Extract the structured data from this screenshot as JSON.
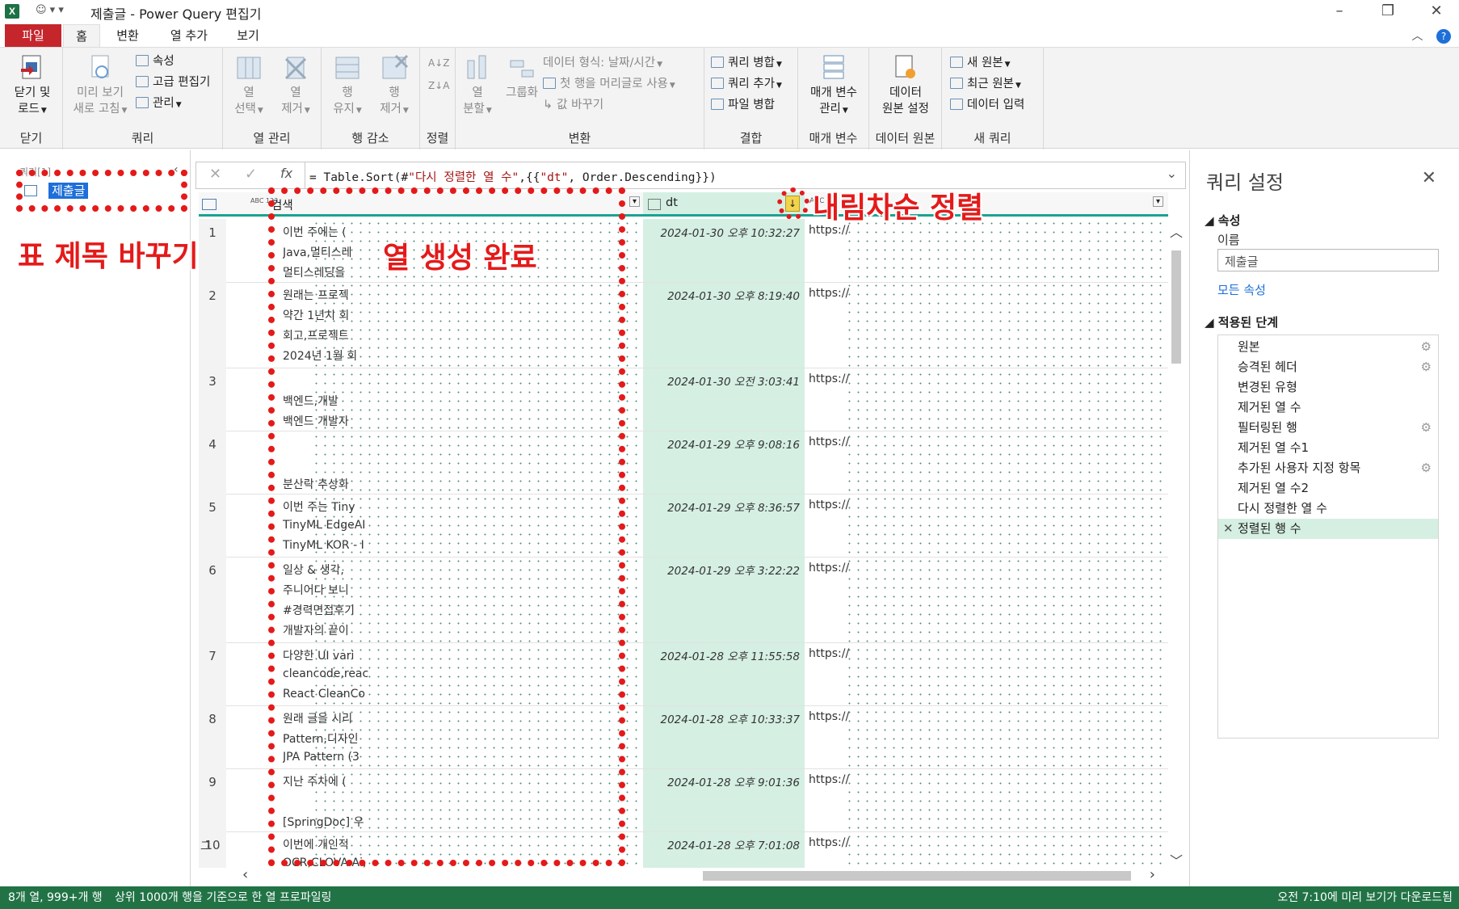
{
  "window": {
    "title": "제출글 - Power Query 편집기",
    "app_icon": "X"
  },
  "tabs": [
    "파일",
    "홈",
    "변환",
    "열 추가",
    "보기"
  ],
  "ribbon": {
    "close": {
      "label1": "닫기 및",
      "label2": "로드",
      "group": "닫기"
    },
    "query": {
      "group": "쿼리",
      "preview1": "미리 보기",
      "preview2": "새로 고침",
      "properties": "속성",
      "advanced": "고급 편집기",
      "manage": "관리"
    },
    "columns": {
      "group": "열 관리",
      "choose1": "열",
      "choose2": "선택",
      "remove1": "열",
      "remove2": "제거"
    },
    "rows": {
      "group": "행 감소",
      "keep1": "행",
      "keep2": "유지",
      "remove1": "행",
      "remove2": "제거"
    },
    "sort": {
      "group": "정렬"
    },
    "transform": {
      "group": "변환",
      "split1": "열",
      "split2": "분할",
      "groupby": "그룹화",
      "datatype": "데이터 형식: 날짜/시간",
      "firstrow": "첫 행을 머리글로 사용",
      "replace": "값 바꾸기"
    },
    "combine": {
      "group": "결합",
      "merge": "쿼리 병합",
      "append": "쿼리 추가",
      "files": "파일 병합"
    },
    "params": {
      "group": "매개 변수",
      "label1": "매개 변수",
      "label2": "관리"
    },
    "source": {
      "group": "데이터 원본",
      "label1": "데이터",
      "label2": "원본 설정"
    },
    "newquery": {
      "group": "새 쿼리",
      "new": "새 원본",
      "recent": "최근 원본",
      "enter": "데이터 입력"
    }
  },
  "queries": {
    "header": "쿼리[1]",
    "item": "제출글"
  },
  "formula": "= Table.Sort(#\"다시 정렬한 열 수\",{{\"dt\", Order.Descending}})",
  "formula_parts": {
    "a": "= Table.Sort(#",
    "b": "\"다시 정렬한 열 수\"",
    "c": ",{{",
    "d": "\"dt\"",
    "e": ", Order.Descending}})"
  },
  "grid": {
    "columns": [
      {
        "type": "ABC 123",
        "name": "검색"
      },
      {
        "type": "",
        "name": "dt"
      },
      {
        "type": "ABC",
        "name": ""
      }
    ],
    "rows": [
      {
        "num": "1",
        "lines": [
          "이번 주에는 (",
          "Java,멀티스레",
          "멀티스레딩을"
        ],
        "dt": "2024-01-30 오후 10:32:27",
        "url": "https://"
      },
      {
        "num": "2",
        "lines": [
          "원래는 프로젝",
          "약간 1년치 회",
          "회고,프로젝트",
          "2024년 1월 회"
        ],
        "dt": "2024-01-30 오후 8:19:40",
        "url": "https://"
      },
      {
        "num": "3",
        "lines": [
          "",
          "백엔드,개발 ",
          "백엔드 개발자"
        ],
        "dt": "2024-01-30 오전 3:03:41",
        "url": "https://"
      },
      {
        "num": "4",
        "lines": [
          "",
          "",
          "분산락 추상화"
        ],
        "dt": "2024-01-29 오후 9:08:16",
        "url": "https://"
      },
      {
        "num": "5",
        "lines": [
          "이번 주는 Tiny",
          "TinyML EdgeAI",
          "TinyML KOR - I"
        ],
        "dt": "2024-01-29 오후 8:36:57",
        "url": "https://"
      },
      {
        "num": "6",
        "lines": [
          "일상 & 생각,",
          "주니어다 보니",
          "#경력면접후기",
          "개발자의 끝이"
        ],
        "dt": "2024-01-29 오후 3:22:22",
        "url": "https://"
      },
      {
        "num": "7",
        "lines": [
          "다양한 UI vari",
          "cleancode,reac",
          "React CleanCo"
        ],
        "dt": "2024-01-28 오후 11:55:58",
        "url": "https://"
      },
      {
        "num": "8",
        "lines": [
          "원래 글을 시리",
          "Pattern,디자인",
          "JPA Pattern (3"
        ],
        "dt": "2024-01-28 오후 10:33:37",
        "url": "https://"
      },
      {
        "num": "9",
        "lines": [
          "지난 주차에 (",
          "",
          "[SpringDoc] 우"
        ],
        "dt": "2024-01-28 오후 9:01:36",
        "url": "https://"
      },
      {
        "num": "10",
        "lines": [
          "이번에 개인적",
          "OCR,CLOVA Ai,"
        ],
        "dt": "2024-01-28 오후 7:01:08",
        "url": "https://"
      }
    ],
    "rownum_extra": "그"
  },
  "settings": {
    "title": "쿼리 설정",
    "props_header": "속성",
    "name_label": "이름",
    "name_value": "제출글",
    "all_props": "모든 속성",
    "steps_header": "적용된 단계",
    "steps": [
      {
        "name": "원본",
        "gear": true
      },
      {
        "name": "승격된 헤더",
        "gear": true
      },
      {
        "name": "변경된 유형",
        "gear": false
      },
      {
        "name": "제거된 열 수",
        "gear": false
      },
      {
        "name": "필터링된 행",
        "gear": true
      },
      {
        "name": "제거된 열 수1",
        "gear": false
      },
      {
        "name": "추가된 사용자 지정 항목",
        "gear": true
      },
      {
        "name": "제거된 열 수2",
        "gear": false
      },
      {
        "name": "다시 정렬한 열 수",
        "gear": false
      },
      {
        "name": "정렬된 행 수",
        "gear": false,
        "selected": true
      }
    ]
  },
  "status": {
    "left1": "8개 열, 999+개 행",
    "left2": "상위 1000개 행을 기준으로 한 열 프로파일링",
    "right": "오전 7:10에 미리 보기가 다운로드됨"
  },
  "annotations": {
    "rename": "표 제목 바꾸기",
    "created": "열 생성 완료",
    "sort": "내림차순 정렬"
  },
  "colors": {
    "file_tab": "#c4262c",
    "status_bar": "#217346",
    "accent_teal": "#1aa391",
    "dt_column_bg": "#d5efe3",
    "annotation_red": "#e41a1a"
  }
}
